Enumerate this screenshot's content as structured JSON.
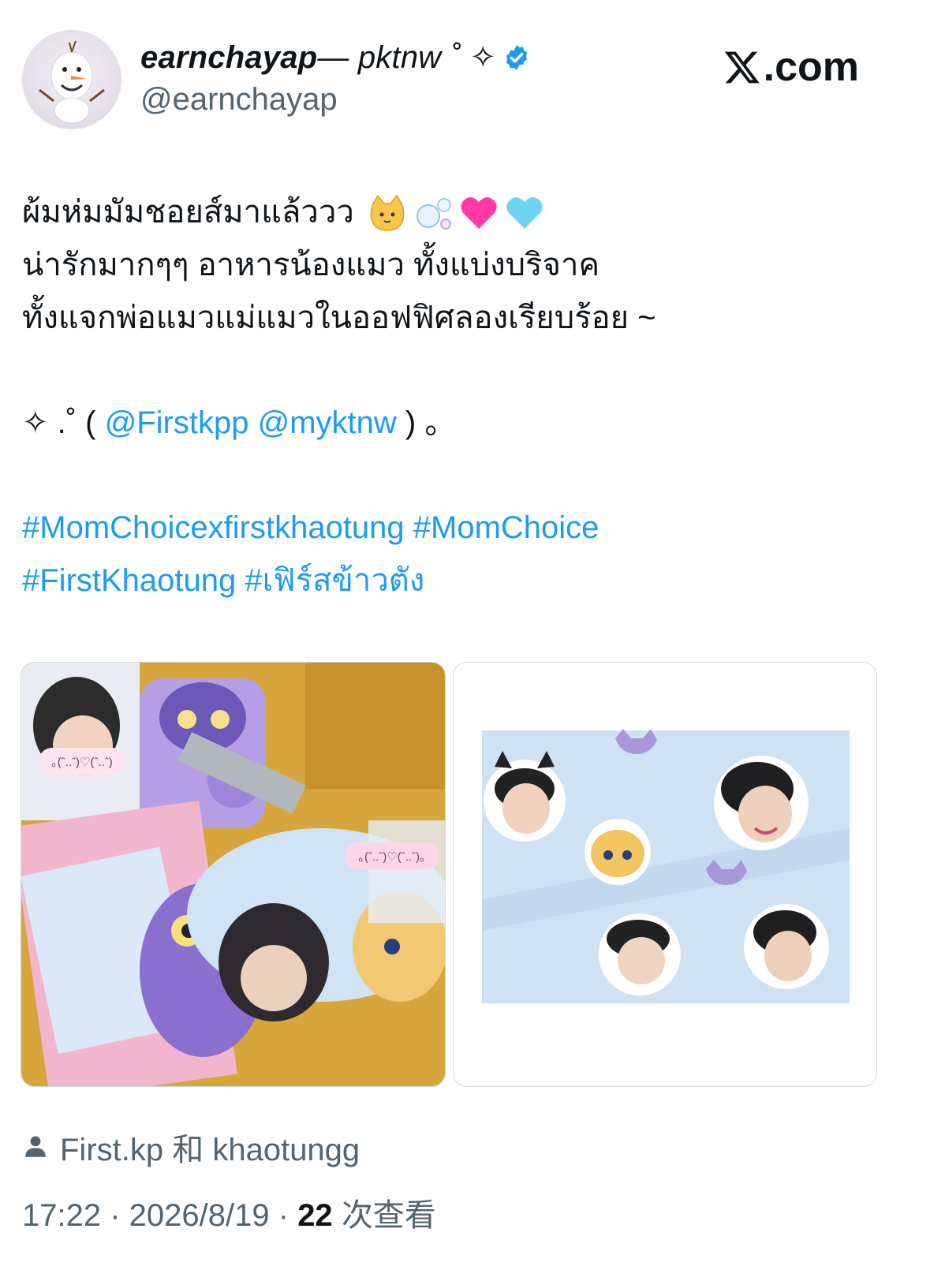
{
  "author": {
    "display_name_bold": "earnchayap",
    "display_name_rest": " — pktnw ˚ ✧",
    "handle": "@earnchayap"
  },
  "brand": {
    "site_label": ".com"
  },
  "tweet": {
    "line1": "ผ้มห่มมัมชอยส์มาแล้ววว",
    "line2": "น่ารักมากๆๆ อาหารน้องแมว ทั้งแบ่งบริจาค",
    "line3": "ทั้งแจกพ่อแมวแม่แมวในออฟฟิศลองเรียบร้อย ~",
    "mention_prefix": "✧ .˚ ( ",
    "mention1": "@Firstkpp",
    "mention2": "@myktnw",
    "mention_suffix": " ) 。",
    "hashtags_line1": "#MomChoicexfirstkhaotung #MomChoice",
    "hashtags_line2": "#FirstKhaotung #เฟิร์สข้าวตัง"
  },
  "photos": {
    "photo1_sticker1": "｡(ˆ..ˆ)♡(ˆ..ˆ)",
    "photo1_sticker2": "｡(ˆ..ˆ)♡(ˆ..ˆ)｡"
  },
  "footer": {
    "tagged_users": "First.kp 和 khaotungg",
    "time": "17:22",
    "date": "2026/8/19",
    "views_count": "22",
    "views_label": "次查看"
  },
  "colors": {
    "link": "#1d9bf0",
    "secondary": "#536471",
    "verified": "#1d9bf0"
  }
}
